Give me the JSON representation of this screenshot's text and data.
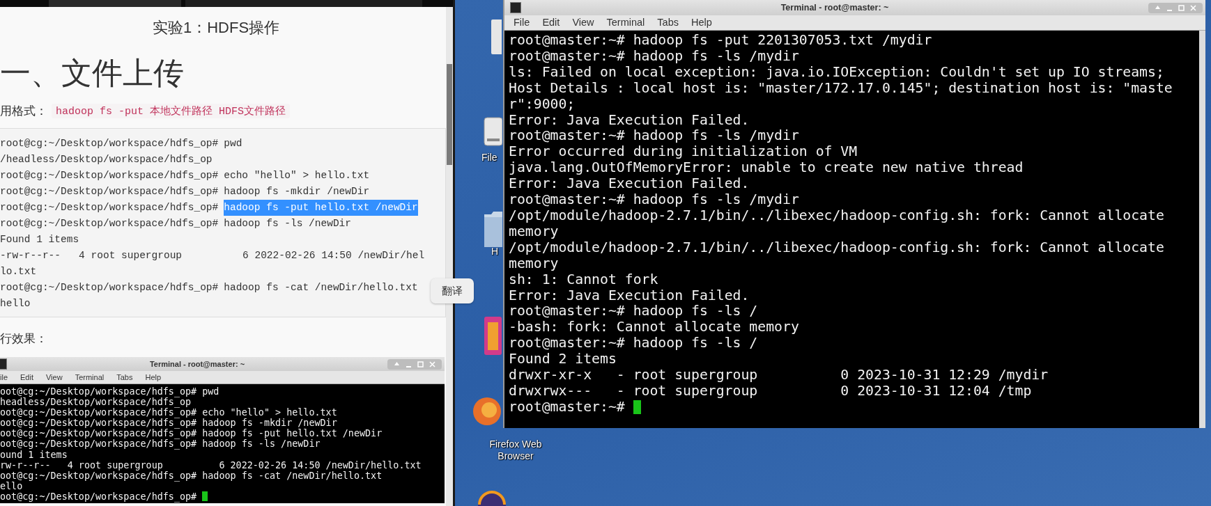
{
  "document": {
    "title": "实验1：HDFS操作",
    "heading": "一、文件上传",
    "usage_label": "用格式：",
    "usage_code": "hadoop fs -put 本地文件路径 HDFS文件路径",
    "code_lines": [
      {
        "kind": "prompt",
        "prompt": "root@cg:~/Desktop/workspace/hdfs_op#",
        "command": "pwd",
        "selected": false
      },
      {
        "kind": "output",
        "text": "/headless/Desktop/workspace/hdfs_op"
      },
      {
        "kind": "prompt",
        "prompt": "root@cg:~/Desktop/workspace/hdfs_op#",
        "command": "echo \"hello\" > hello.txt",
        "selected": false
      },
      {
        "kind": "prompt",
        "prompt": "root@cg:~/Desktop/workspace/hdfs_op#",
        "command": "hadoop fs -mkdir /newDir",
        "selected": false
      },
      {
        "kind": "prompt",
        "prompt": "root@cg:~/Desktop/workspace/hdfs_op#",
        "command": "hadoop fs -put hello.txt /newDir",
        "selected": true
      },
      {
        "kind": "prompt",
        "prompt": "root@cg:~/Desktop/workspace/hdfs_op#",
        "command": "hadoop fs -ls /newDir",
        "selected": false
      },
      {
        "kind": "output",
        "text": "Found 1 items"
      },
      {
        "kind": "output",
        "text": "-rw-r--r--   4 root supergroup          6 2022-02-26 14:50 /newDir/hel"
      },
      {
        "kind": "output",
        "text": "lo.txt"
      },
      {
        "kind": "prompt",
        "prompt": "root@cg:~/Desktop/workspace/hdfs_op#",
        "command": "hadoop fs -cat /newDir/hello.txt",
        "selected": false
      },
      {
        "kind": "output",
        "text": "hello"
      }
    ],
    "translate_button": "翻译",
    "result_label": "行效果：",
    "result_terminal": {
      "title": "Terminal - root@master: ~",
      "menu": [
        "ile",
        "Edit",
        "View",
        "Terminal",
        "Tabs",
        "Help"
      ],
      "lines": [
        "oot@cg:~/Desktop/workspace/hdfs_op# pwd",
        "headless/Desktop/workspace/hdfs_op",
        "oot@cg:~/Desktop/workspace/hdfs_op# echo \"hello\" > hello.txt",
        "oot@cg:~/Desktop/workspace/hdfs_op# hadoop fs -mkdir /newDir",
        "oot@cg:~/Desktop/workspace/hdfs_op# hadoop fs -put hello.txt /newDir",
        "oot@cg:~/Desktop/workspace/hdfs_op# hadoop fs -ls /newDir",
        "ound 1 items",
        "rw-r--r--   4 root supergroup          6 2022-02-26 14:50 /newDir/hello.txt",
        "oot@cg:~/Desktop/workspace/hdfs_op# hadoop fs -cat /newDir/hello.txt",
        "ello",
        "oot@cg:~/Desktop/workspace/hdfs_op#"
      ]
    }
  },
  "desktop": {
    "icons": [
      {
        "kind": "drive",
        "label": "File"
      },
      {
        "kind": "folder",
        "label": "H"
      },
      {
        "kind": "firefox",
        "label": "Firefox Web Browser"
      }
    ],
    "terminal": {
      "title": "Terminal - root@master: ~",
      "menu": [
        "File",
        "Edit",
        "View",
        "Terminal",
        "Tabs",
        "Help"
      ],
      "lines": [
        "root@master:~# hadoop fs -put 2201307053.txt /mydir",
        "root@master:~# hadoop fs -ls /mydir",
        "ls: Failed on local exception: java.io.IOException: Couldn't set up IO streams;",
        "Host Details : local host is: \"master/172.17.0.145\"; destination host is: \"maste",
        "r\":9000;",
        "Error: Java Execution Failed.",
        "root@master:~# hadoop fs -ls /mydir",
        "Error occurred during initialization of VM",
        "java.lang.OutOfMemoryError: unable to create new native thread",
        "Error: Java Execution Failed.",
        "root@master:~# hadoop fs -ls /mydir",
        "/opt/module/hadoop-2.7.1/bin/../libexec/hadoop-config.sh: fork: Cannot allocate",
        "memory",
        "/opt/module/hadoop-2.7.1/bin/../libexec/hadoop-config.sh: fork: Cannot allocate",
        "memory",
        "sh: 1: Cannot fork",
        "Error: Java Execution Failed.",
        "root@master:~# hadoop fs -ls /",
        "-bash: fork: Cannot allocate memory",
        "root@master:~# hadoop fs -ls /",
        "Found 2 items",
        "drwxr-xr-x   - root supergroup          0 2023-10-31 12:29 /mydir",
        "drwxrwx---   - root supergroup          0 2023-10-31 12:04 /tmp",
        "root@master:~#"
      ]
    }
  }
}
